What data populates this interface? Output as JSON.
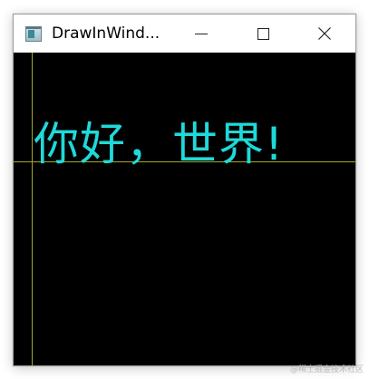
{
  "window": {
    "title": "DrawInWind...",
    "icons": {
      "app": "app-window-icon",
      "minimize": "minimize-icon",
      "maximize": "maximize-icon",
      "close": "close-icon"
    },
    "close_glyph": "✕"
  },
  "canvas": {
    "background": "#000000",
    "text": "你好，世界!",
    "text_color": "#1fd9d9",
    "guide_color": "#a3a82a"
  },
  "watermark": "@稀土掘金技术社区"
}
